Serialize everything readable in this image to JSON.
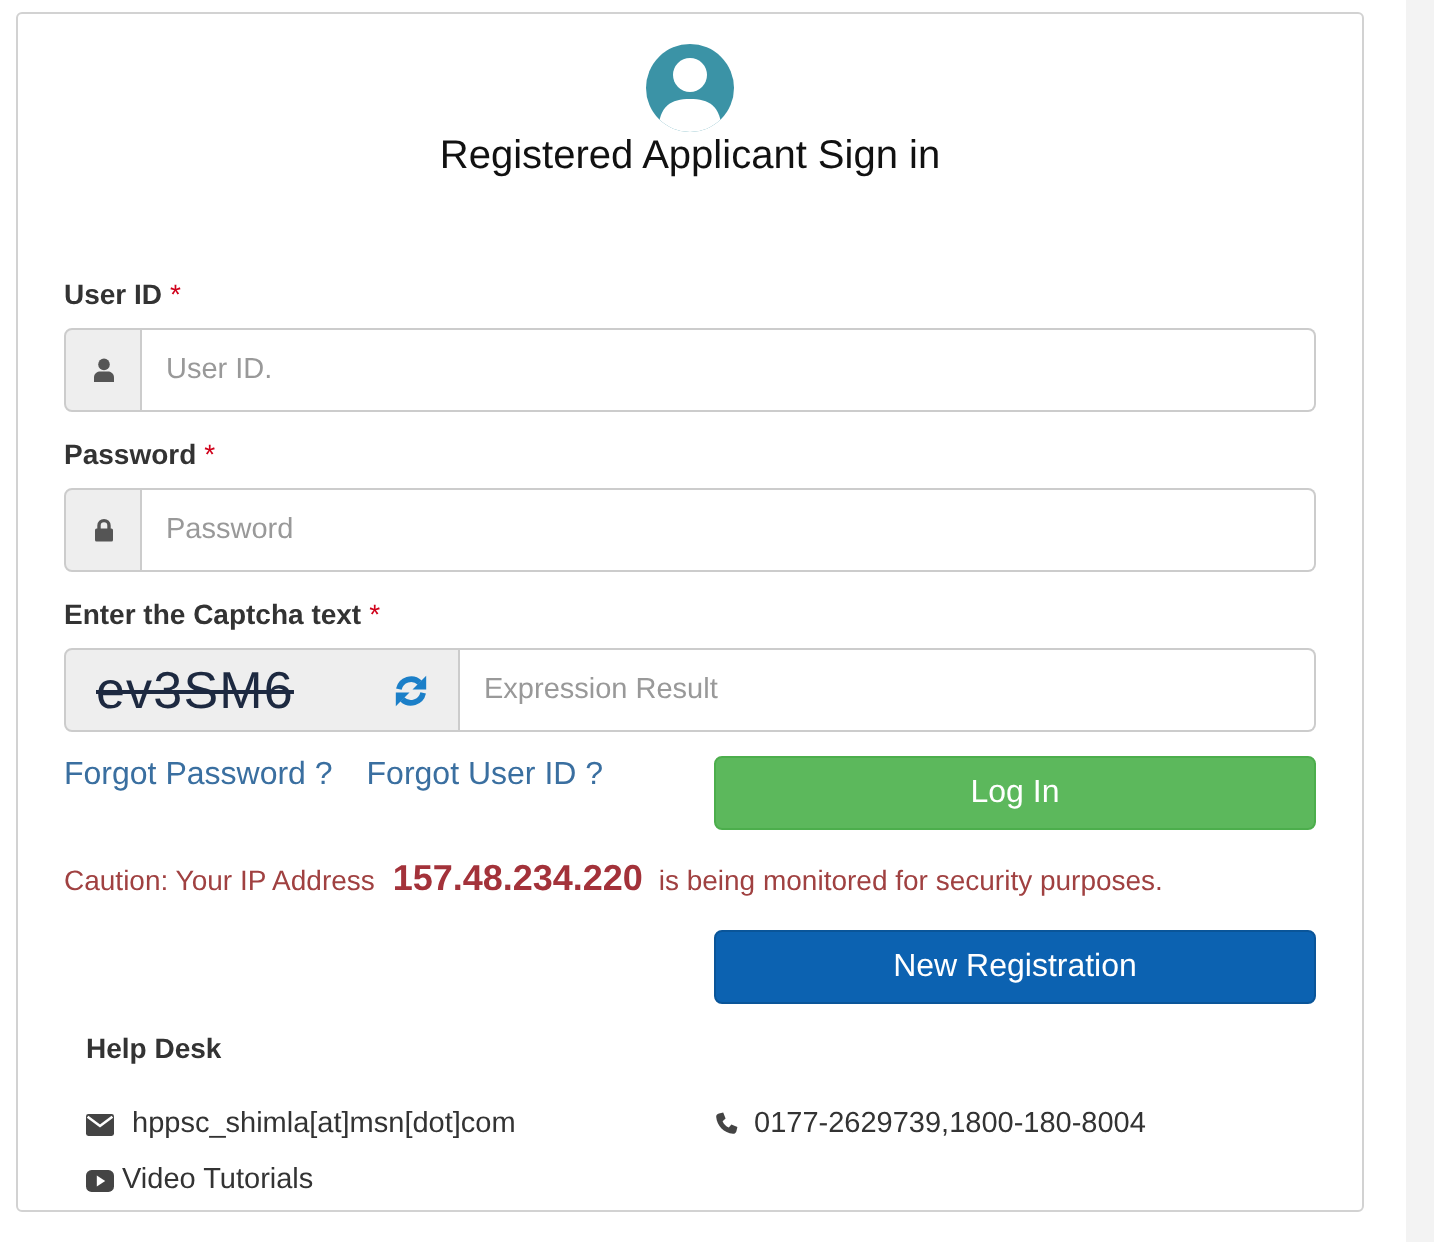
{
  "header": {
    "title": "Registered Applicant Sign in"
  },
  "fields": [
    {
      "kind": "user",
      "label": "User ID",
      "required_mark": "*",
      "placeholder": "User ID."
    },
    {
      "kind": "password",
      "label": "Password",
      "required_mark": "*",
      "placeholder": "Password"
    },
    {
      "kind": "captcha",
      "label": "Enter the Captcha text",
      "required_mark": "*",
      "captcha": "ev3SM6",
      "placeholder": "Expression Result"
    }
  ],
  "links": [
    "Forgot Password ?",
    "Forgot User ID ?"
  ],
  "login_button": "Log In",
  "caution": "Caution: Your IP Address **157.48.234.220** is being monitored for security purposes.",
  "register_button": "New Registration",
  "help_desk": {
    "title": "Help Desk",
    "items": [
      {
        "kind": "email",
        "text": "hppsc_shimla[at]msn[dot]com"
      },
      {
        "kind": "phone",
        "text": "0177-2629739,1800-180-8004"
      },
      {
        "kind": "video",
        "text": "Video Tutorials"
      }
    ]
  }
}
